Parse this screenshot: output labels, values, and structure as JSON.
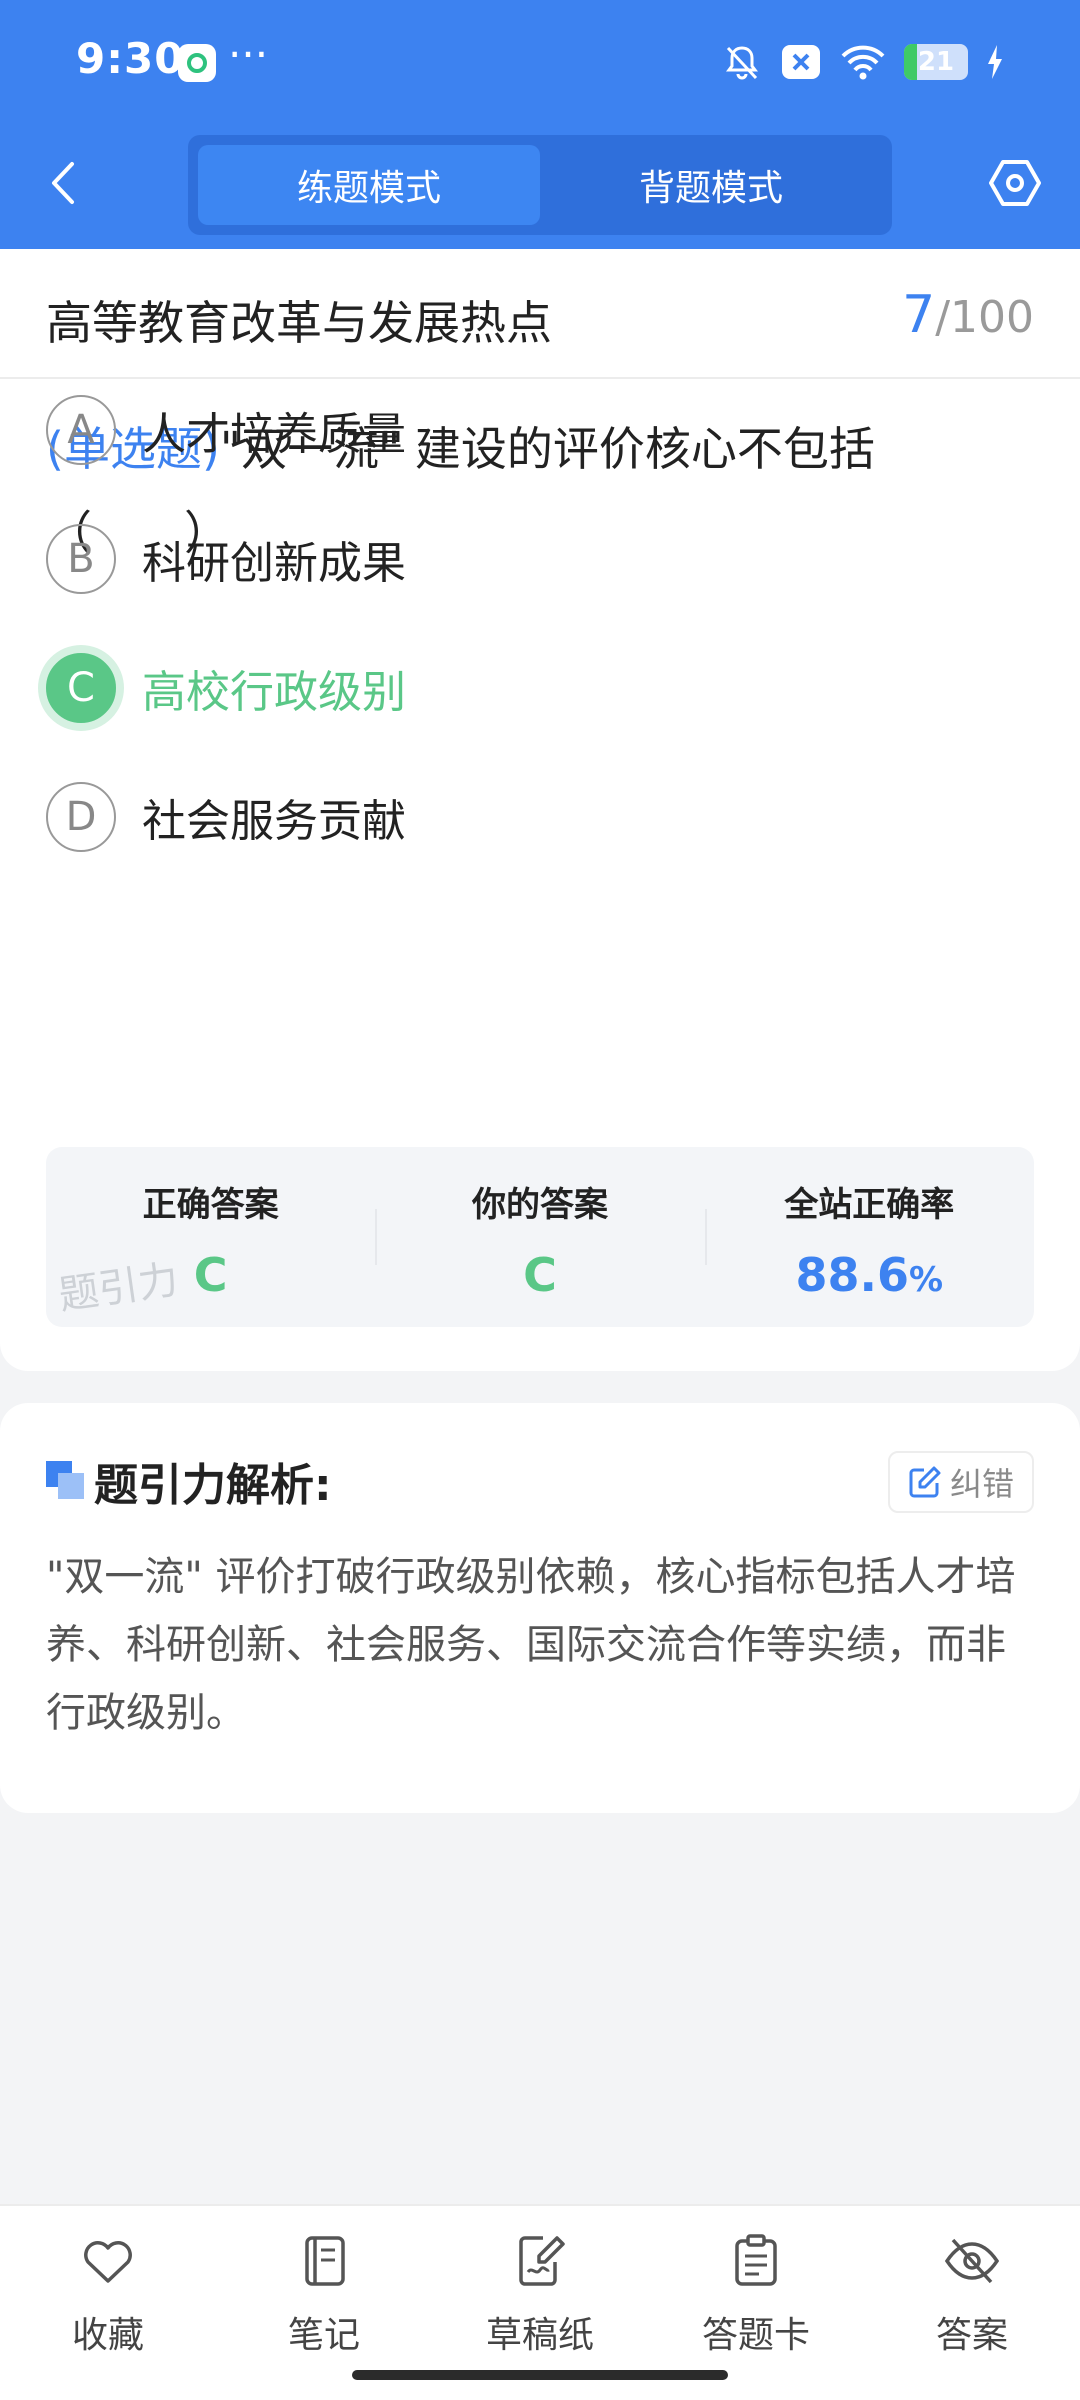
{
  "status_bar": {
    "time": "9:30",
    "more": "···",
    "battery_level": "21",
    "battery_fraction": 0.21
  },
  "nav": {
    "tabs": [
      {
        "label": "练题模式",
        "active": true
      },
      {
        "label": "背题模式",
        "active": false
      }
    ]
  },
  "question": {
    "category": "高等教育改革与发展热点",
    "progress_current": "7",
    "progress_total": "/100",
    "type_label": "(单选题)",
    "text": "\"双一流\" 建设的评价核心不包括",
    "blank": "（　　）",
    "options": [
      {
        "letter": "A",
        "text": "人才培养质量"
      },
      {
        "letter": "B",
        "text": "科研创新成果"
      },
      {
        "letter": "C",
        "text": "高校行政级别",
        "selected_correct": true
      },
      {
        "letter": "D",
        "text": "社会服务贡献"
      }
    ]
  },
  "stats": {
    "correct_label": "正确答案",
    "correct_value": "C",
    "yours_label": "你的答案",
    "yours_value": "C",
    "rate_label": "全站正确率",
    "rate_value": "88.6",
    "rate_unit": "%",
    "watermark": "题引力"
  },
  "analysis": {
    "title": "题引力解析:",
    "report_label": "纠错",
    "text": "\"双一流\" 评价打破行政级别依赖，核心指标包括人才培养、科研创新、社会服务、国际交流合作等实绩，而非行政级别。"
  },
  "bottom_tabs": [
    {
      "label": "收藏",
      "icon": "heart-icon"
    },
    {
      "label": "笔记",
      "icon": "notebook-icon"
    },
    {
      "label": "草稿纸",
      "icon": "draft-paper-icon"
    },
    {
      "label": "答题卡",
      "icon": "answer-sheet-icon"
    },
    {
      "label": "答案",
      "icon": "eye-off-icon"
    }
  ],
  "colors": {
    "primary": "#3d82f0",
    "correct": "#5ac787",
    "background": "#f3f4f6"
  }
}
